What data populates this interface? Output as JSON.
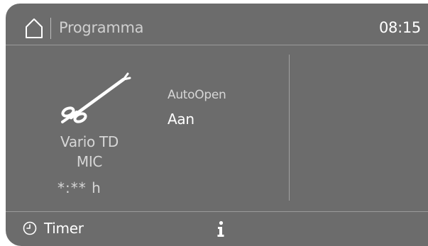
{
  "header": {
    "title": "Programma",
    "time": "08:15",
    "home_icon": "home-icon"
  },
  "program": {
    "icon": "instrument-icon",
    "name_line1": "Vario TD",
    "name_line2": "MIC",
    "duration": "*:** h"
  },
  "option": {
    "label": "AutoOpen",
    "value": "Aan"
  },
  "footer": {
    "timer_label": "Timer",
    "timer_icon": "clock-icon",
    "info_icon": "info-icon"
  },
  "colors": {
    "background": "#6c6c6c",
    "text_primary": "#ffffff",
    "text_secondary": "#d6d6d6",
    "divider": "#9a9a9a"
  }
}
